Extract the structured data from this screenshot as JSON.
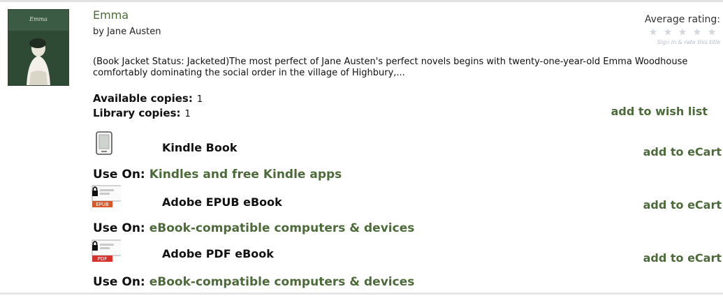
{
  "book": {
    "title": "Emma",
    "author": "by Jane Austen",
    "cover_caption": "Emma",
    "description": "(Book Jacket Status: Jacketed)The most perfect of Jane Austen's perfect novels begins with twenty-one-year-old Emma Woodhouse comfortably dominating the social order in the village of Highbury,...",
    "available_label": "Available copies:",
    "available_value": "1",
    "library_label": "Library copies:",
    "library_value": "1"
  },
  "rating": {
    "label": "Average rating:",
    "stars_filled": 0,
    "stars_total": 5,
    "signin_text": "Sign in & rate this title"
  },
  "actions": {
    "wishlist": "add to wish list"
  },
  "formats": [
    {
      "name": "Kindle Book",
      "icon": "kindle-device-icon",
      "cart": "add to eCart",
      "useon_label": "Use On:",
      "useon_link": "Kindles and free Kindle apps"
    },
    {
      "name": "Adobe EPUB eBook",
      "icon": "epub-lock-icon",
      "icon_tag": "EPUB",
      "cart": "add to eCart",
      "useon_label": "Use On:",
      "useon_link": "eBook-compatible computers & devices"
    },
    {
      "name": "Adobe PDF eBook",
      "icon": "pdf-lock-icon",
      "icon_tag": "PDF",
      "cart": "add to eCart",
      "useon_label": "Use On:",
      "useon_link": "eBook-compatible computers & devices"
    }
  ],
  "colors": {
    "link_green": "#4d6b3a",
    "epub_tag": "#d4582b",
    "pdf_tag": "#d8302a"
  }
}
